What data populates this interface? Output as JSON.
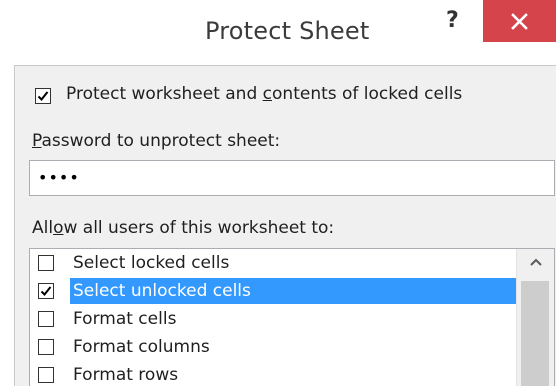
{
  "window": {
    "title": "Protect Sheet",
    "help_label": "?",
    "close_icon": "close-icon"
  },
  "protect": {
    "label_pre": "Protect worksheet and ",
    "label_accel": "c",
    "label_post": "ontents of locked cells",
    "checked": true
  },
  "password": {
    "label_accel": "P",
    "label_post": "assword to unprotect sheet:",
    "value_masked": "••••"
  },
  "allow": {
    "label_pre": "All",
    "label_accel": "o",
    "label_post": "w all users of this worksheet to:"
  },
  "permissions": [
    {
      "label": "Select locked cells",
      "checked": false,
      "selected": false
    },
    {
      "label": "Select unlocked cells",
      "checked": true,
      "selected": true
    },
    {
      "label": "Format cells",
      "checked": false,
      "selected": false
    },
    {
      "label": "Format columns",
      "checked": false,
      "selected": false
    },
    {
      "label": "Format rows",
      "checked": false,
      "selected": false
    }
  ],
  "colors": {
    "close": "#d4444a",
    "selection": "#3399ff",
    "panel": "#f0f0f0"
  }
}
